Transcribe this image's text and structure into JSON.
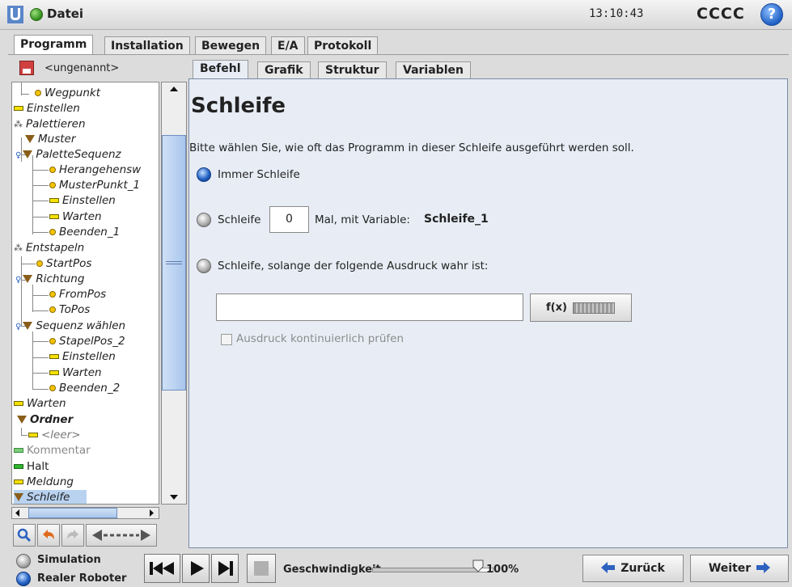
{
  "titlebar": {
    "file_menu": "Datei",
    "time": "13:10:43",
    "robot_name": "CCCC",
    "help_label": "?"
  },
  "top_tabs": [
    "Programm",
    "Installation",
    "Bewegen",
    "E/A",
    "Protokoll"
  ],
  "program": {
    "name": "<ungenannt>"
  },
  "tree": [
    {
      "label": "Wegpunkt",
      "icon": "waypoint"
    },
    {
      "label": "Einstellen",
      "icon": "set"
    },
    {
      "label": "Palettieren",
      "icon": "pallet"
    },
    {
      "label": "Muster",
      "icon": "folder"
    },
    {
      "label": "PaletteSequenz",
      "icon": "folder"
    },
    {
      "label": "Herangehensw",
      "icon": "waypoint"
    },
    {
      "label": "MusterPunkt_1",
      "icon": "waypoint"
    },
    {
      "label": "Einstellen",
      "icon": "set"
    },
    {
      "label": "Warten",
      "icon": "set"
    },
    {
      "label": "Beenden_1",
      "icon": "waypoint"
    },
    {
      "label": "Entstapeln",
      "icon": "pallet"
    },
    {
      "label": "StartPos",
      "icon": "waypoint"
    },
    {
      "label": "Richtung",
      "icon": "folder"
    },
    {
      "label": "FromPos",
      "icon": "waypoint"
    },
    {
      "label": "ToPos",
      "icon": "waypoint"
    },
    {
      "label": "Sequenz wählen",
      "icon": "folder"
    },
    {
      "label": "StapelPos_2",
      "icon": "waypoint"
    },
    {
      "label": "Einstellen",
      "icon": "set"
    },
    {
      "label": "Warten",
      "icon": "set"
    },
    {
      "label": "Beenden_2",
      "icon": "waypoint"
    },
    {
      "label": "Warten",
      "icon": "set"
    },
    {
      "label": "Ordner",
      "icon": "folder"
    },
    {
      "label": "<leer>",
      "icon": "set"
    },
    {
      "label": "Kommentar",
      "icon": "comment"
    },
    {
      "label": "Halt",
      "icon": "halt"
    },
    {
      "label": "Meldung",
      "icon": "set"
    },
    {
      "label": "Schleife",
      "icon": "folder",
      "selected": true
    }
  ],
  "sub_tabs": [
    "Befehl",
    "Grafik",
    "Struktur",
    "Variablen"
  ],
  "command": {
    "heading": "Schleife",
    "description": "Bitte wählen Sie, wie oft das Programm in dieser Schleife ausgeführt werden soll.",
    "option_always": "Immer Schleife",
    "option_count_prefix": "Schleife",
    "loop_count": "0",
    "option_count_suffix": "Mal, mit Variable:",
    "loop_variable": "Schleife_1",
    "option_expression": "Schleife, solange der folgende Ausdruck wahr ist:",
    "expression_value": "",
    "fx_label": "f(x)",
    "continuous_check": "Ausdruck kontinuierlich prüfen"
  },
  "bottom": {
    "mode_simulation": "Simulation",
    "mode_real": "Realer Roboter",
    "speed_label": "Geschwindigkeit",
    "speed_value": "100%",
    "speed_fraction": 1.0,
    "back": "Zurück",
    "next": "Weiter"
  },
  "colors": {
    "accent_blue": "#2563c6",
    "panel_bg": "#e8edf5",
    "selection": "#b8d2f0"
  }
}
